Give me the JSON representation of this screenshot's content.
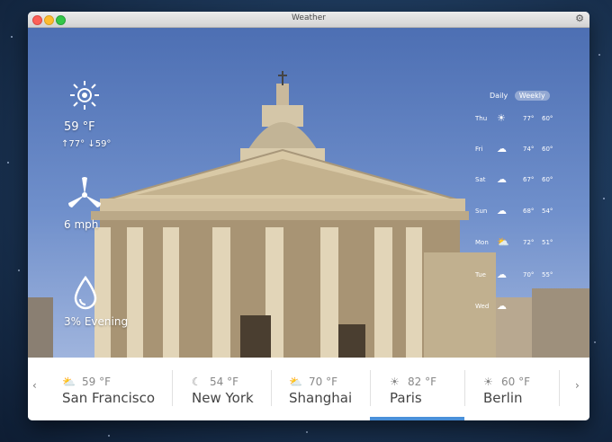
{
  "window": {
    "title": "Weather"
  },
  "current": {
    "temperature": "59 °F",
    "high": "77°",
    "low": "59°",
    "wind": "6 mph",
    "precip": "3% Evening"
  },
  "forecast": {
    "tabs": [
      "Daily",
      "Weekly"
    ],
    "active_tab": "Weekly",
    "days": [
      {
        "day": "Thu",
        "icon": "sun-icon",
        "high": "77°",
        "low": "60°"
      },
      {
        "day": "Fri",
        "icon": "rain-cloud-icon",
        "high": "74°",
        "low": "60°"
      },
      {
        "day": "Sat",
        "icon": "rain-cloud-icon",
        "high": "67°",
        "low": "60°"
      },
      {
        "day": "Sun",
        "icon": "rain-cloud-icon",
        "high": "68°",
        "low": "54°"
      },
      {
        "day": "Mon",
        "icon": "partly-cloudy-icon",
        "high": "72°",
        "low": "51°"
      },
      {
        "day": "Tue",
        "icon": "rain-cloud-icon",
        "high": "70°",
        "low": "55°"
      },
      {
        "day": "Wed",
        "icon": "rain-cloud-icon",
        "high": "",
        "low": ""
      }
    ]
  },
  "cities": [
    {
      "name": "San Francisco",
      "temp": "59 °F",
      "icon": "partly-cloudy-icon"
    },
    {
      "name": "New York",
      "temp": "54 °F",
      "icon": "moon-icon"
    },
    {
      "name": "Shanghai",
      "temp": "70 °F",
      "icon": "partly-cloudy-icon"
    },
    {
      "name": "Paris",
      "temp": "82 °F",
      "icon": "sun-icon"
    },
    {
      "name": "Berlin",
      "temp": "60 °F",
      "icon": "sun-icon"
    }
  ],
  "selected_city": "Paris"
}
